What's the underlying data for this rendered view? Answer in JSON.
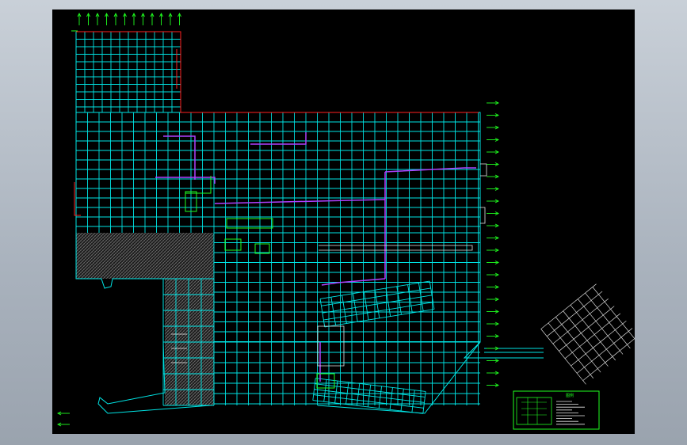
{
  "window": {
    "background": "#a9b2bd",
    "canvas_background": "#000000"
  },
  "drawing": {
    "colors": {
      "grid": "#00e5e5",
      "boundary": "#ff2020",
      "purple": "#b040ff",
      "green": "#20ff20",
      "hatch": "#6a6a6a",
      "white": "#e8e8e8"
    },
    "icons": [
      "north-arrow-icon",
      "axis-marker-icon",
      "title-block-icon"
    ]
  },
  "legend": {
    "title": "图例"
  }
}
